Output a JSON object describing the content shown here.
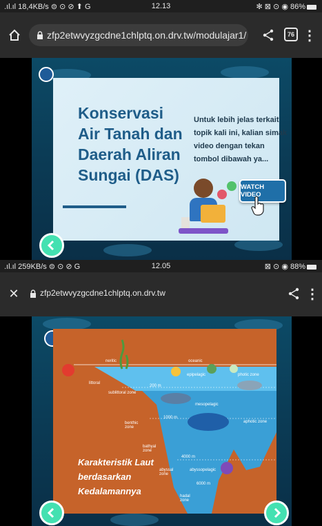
{
  "top": {
    "status": {
      "left": ".ıl.ıl 18,4KB/s ⊜ ⊙ ⊘ ⬆ G",
      "time": "12.13",
      "right": "✻ ⊠ ⊙ ◉ 86%"
    },
    "url": "zfp2etwvyzgcdne1chlptq.on.drv.tw/modulajar1/",
    "tab_count": "76",
    "slide": {
      "title": "Konservasi Air Tanah dan Daerah Aliran Sungai (DAS)",
      "body": "Untuk lebih jelas terkait topik kali ini, kalian simak video dengan tekan tombol dibawah ya...",
      "watch_label": "WATCH VIDEO"
    }
  },
  "bottom": {
    "status": {
      "left": ".ıl.ıl 259KB/s ⊜ ⊙ ⊘ G",
      "time": "12.05",
      "right": "⊠ ⊙ ◉ 88%"
    },
    "url": "zfp2etwvyzgcdne1chlptq.on.drv.tw",
    "slide": {
      "title": "Karakteristik Laut berdasarkan Kedalamannya",
      "labels": {
        "neritic": "neritic",
        "oceanic": "oceanic",
        "littoral": "littoral",
        "sublittoral": "sublittoral zone",
        "epipelagic": "epipelagic",
        "photic": "photic zone",
        "m200": "200 m",
        "mesopelagic": "mesopelagic",
        "m1000": "1000 m",
        "benthic": "benthic zone",
        "aphotic": "aphotic zone",
        "bathyal": "bathyal zone",
        "m4000": "4000 m",
        "abyssal": "abyssal zone",
        "abyssopelagic": "abyssopelagic",
        "m6000": "6000 m",
        "hadal": "hadal zone"
      }
    }
  }
}
